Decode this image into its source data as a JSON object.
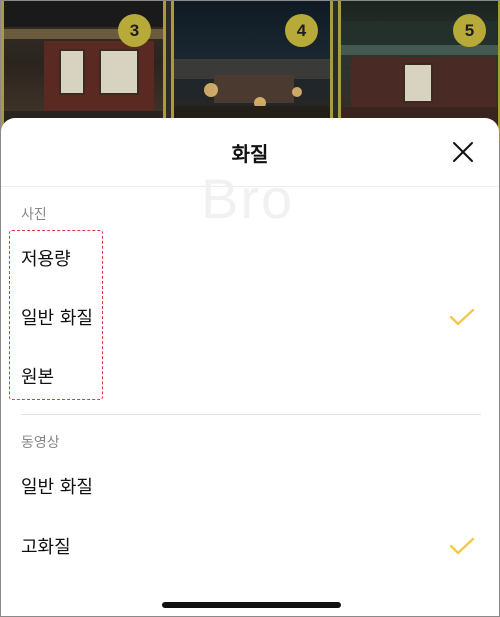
{
  "thumbnails": [
    {
      "badge": "3"
    },
    {
      "badge": "4"
    },
    {
      "badge": "5"
    }
  ],
  "sheet": {
    "title": "화질",
    "watermark": "Bro"
  },
  "photo_section": {
    "label": "사진",
    "options": [
      {
        "label": "저용량",
        "selected": false
      },
      {
        "label": "일반 화질",
        "selected": true
      },
      {
        "label": "원본",
        "selected": false
      }
    ]
  },
  "video_section": {
    "label": "동영상",
    "options": [
      {
        "label": "일반 화질",
        "selected": false
      },
      {
        "label": "고화질",
        "selected": true
      }
    ]
  },
  "colors": {
    "accent_check": "#f2c94c",
    "badge": "#b8aa38",
    "highlight": "#d93a3a"
  },
  "icons": {
    "close": "close-icon",
    "check": "check-icon"
  }
}
